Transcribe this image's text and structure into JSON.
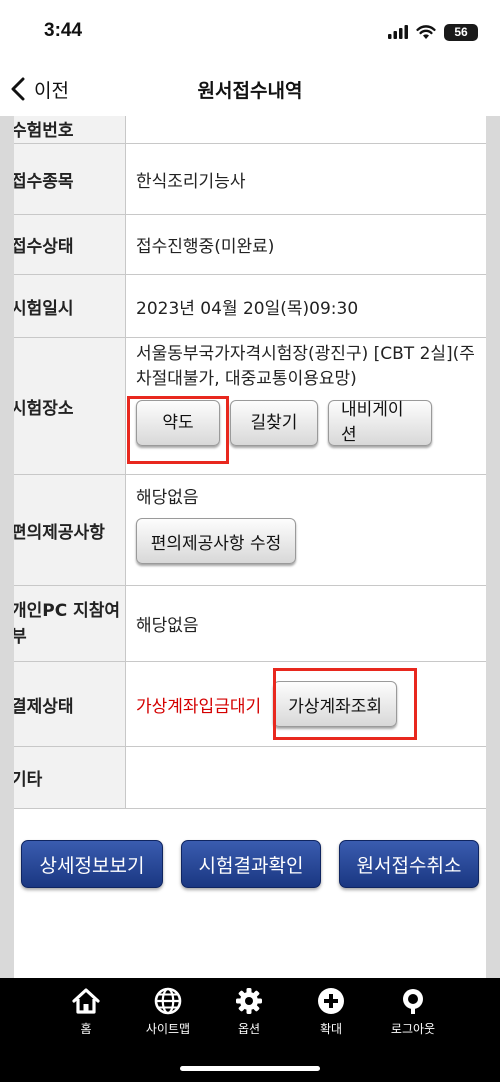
{
  "status_bar": {
    "time": "3:44",
    "battery": "56"
  },
  "nav": {
    "back_label": "이전",
    "title": "원서접수내역"
  },
  "rows": [
    {
      "label": "수험번호",
      "value": ""
    },
    {
      "label": "접수종목",
      "value": "한식조리기능사"
    },
    {
      "label": "접수상태",
      "value": "접수진행중(미완료)"
    },
    {
      "label": "시험일시",
      "value": "2023년 04월 20일(목)09:30"
    },
    {
      "label": "시험장소",
      "value": "서울동부국가자격시험장(광진구) [CBT 2실](주차절대불가, 대중교통이용요망)",
      "buttons": [
        "약도",
        "길찾기",
        "내비게이션"
      ]
    },
    {
      "label": "편의제공사항",
      "value": "해당없음",
      "buttons": [
        "편의제공사항 수정"
      ]
    },
    {
      "label": "개인PC 지참여부",
      "value": "해당없음"
    },
    {
      "label": "결제상태",
      "value": "가상계좌입금대기",
      "buttons": [
        "가상계좌조회"
      ]
    },
    {
      "label": "기타",
      "value": ""
    }
  ],
  "actions": [
    "상세정보보기",
    "시험결과확인",
    "원서접수취소"
  ],
  "tabs": [
    {
      "label": "홈",
      "icon": "home-icon"
    },
    {
      "label": "사이트맵",
      "icon": "globe-icon"
    },
    {
      "label": "옵션",
      "icon": "gear-icon"
    },
    {
      "label": "확대",
      "icon": "plus-circle-icon"
    },
    {
      "label": "로그아웃",
      "icon": "logout-icon"
    }
  ],
  "colors": {
    "highlight": "#e8281e",
    "status_red": "#d40000",
    "button_blue": "#1a3782"
  }
}
